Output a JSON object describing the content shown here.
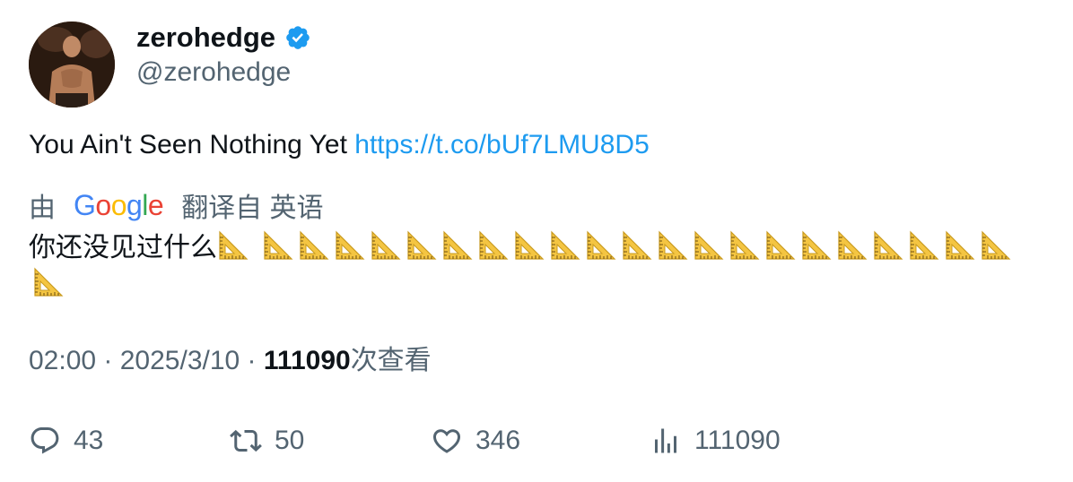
{
  "author": {
    "display_name": "zerohedge",
    "handle": "@zerohedge",
    "verified_color": "#1d9bf0"
  },
  "tweet": {
    "text": "You Ain't Seen Nothing Yet ",
    "link": "https://t.co/bUf7LMU8D5"
  },
  "translation": {
    "by_label": "由",
    "provider": "Google",
    "from_label": "翻译自 英语",
    "text": "你还没见过什么",
    "emoji_name": "triangular-ruler",
    "emoji_count": 23
  },
  "meta": {
    "time": "02:00",
    "sep1": " · ",
    "date": "2025/3/10",
    "sep2": " · ",
    "views_count": "111090",
    "views_label": "次查看"
  },
  "actions": {
    "replies": "43",
    "retweets": "50",
    "likes": "346",
    "views": "111090"
  }
}
